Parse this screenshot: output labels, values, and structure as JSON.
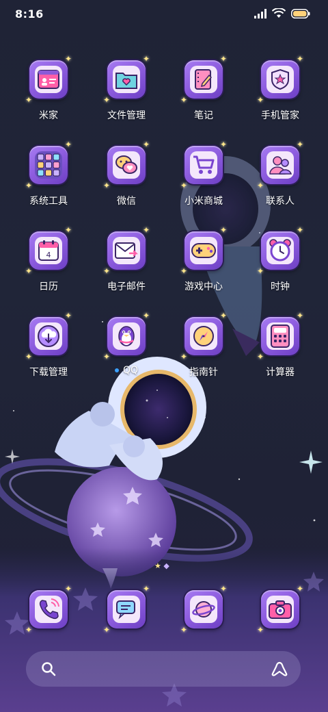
{
  "status_bar": {
    "time": "8:16",
    "icons": [
      "signal-icon",
      "wifi-icon",
      "battery-icon"
    ]
  },
  "apps": [
    {
      "label": "米家",
      "icon": "mi-home-icon"
    },
    {
      "label": "文件管理",
      "icon": "folder-heart-icon"
    },
    {
      "label": "笔记",
      "icon": "notes-icon"
    },
    {
      "label": "手机管家",
      "icon": "shield-star-icon"
    },
    {
      "label": "系统工具",
      "icon": "tools-folder-icon"
    },
    {
      "label": "微信",
      "icon": "wechat-icon"
    },
    {
      "label": "小米商城",
      "icon": "shopping-cart-icon"
    },
    {
      "label": "联系人",
      "icon": "contacts-icon"
    },
    {
      "label": "日历",
      "icon": "calendar-icon",
      "badge_text": "4"
    },
    {
      "label": "电子邮件",
      "icon": "mail-icon"
    },
    {
      "label": "游戏中心",
      "icon": "gamepad-icon"
    },
    {
      "label": "时钟",
      "icon": "alarm-clock-icon"
    },
    {
      "label": "下载管理",
      "icon": "download-cloud-icon"
    },
    {
      "label": "QQ",
      "icon": "qq-penguin-icon",
      "new_dot": true
    },
    {
      "label": "指南针",
      "icon": "compass-icon"
    },
    {
      "label": "计算器",
      "icon": "calculator-icon"
    }
  ],
  "dock": [
    {
      "icon": "phone-icon"
    },
    {
      "icon": "messages-icon"
    },
    {
      "icon": "browser-planet-icon"
    },
    {
      "icon": "camera-icon"
    }
  ],
  "search_bar": {
    "left_icon": "search-icon",
    "right_icon": "assistant-icon"
  },
  "colors": {
    "background": "#1f2336",
    "tile_purple": "#8f5ee0",
    "tile_inner": "#f4e7fb",
    "accent_pink": "#ff5fa8",
    "sparkle": "#ffe68a"
  }
}
